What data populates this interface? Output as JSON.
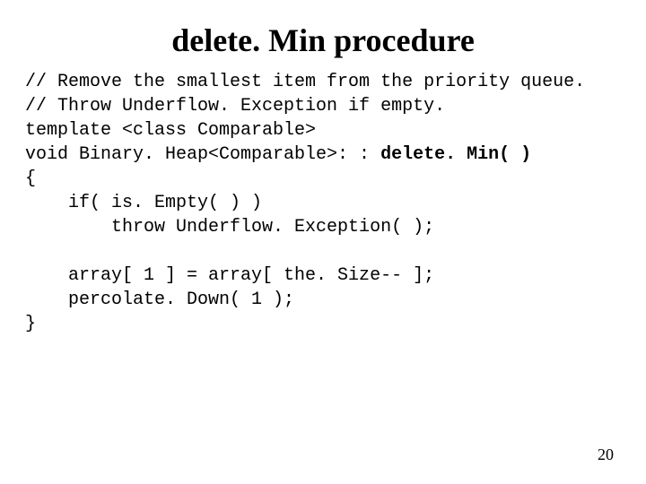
{
  "title": "delete. Min procedure",
  "page_number": "20",
  "code": {
    "l1": "// Remove the smallest item from the priority queue.",
    "l2": "// Throw Underflow. Exception if empty.",
    "l3": "template <class Comparable>",
    "l4a": "void Binary. Heap<Comparable>: : ",
    "l4b": "delete. Min( )",
    "l5": "{",
    "l6": "    if( is. Empty( ) )",
    "l7": "        throw Underflow. Exception( );",
    "l8": "",
    "l9": "    array[ 1 ] = array[ the. Size-- ];",
    "l10": "    percolate. Down( 1 );",
    "l11": "}"
  }
}
